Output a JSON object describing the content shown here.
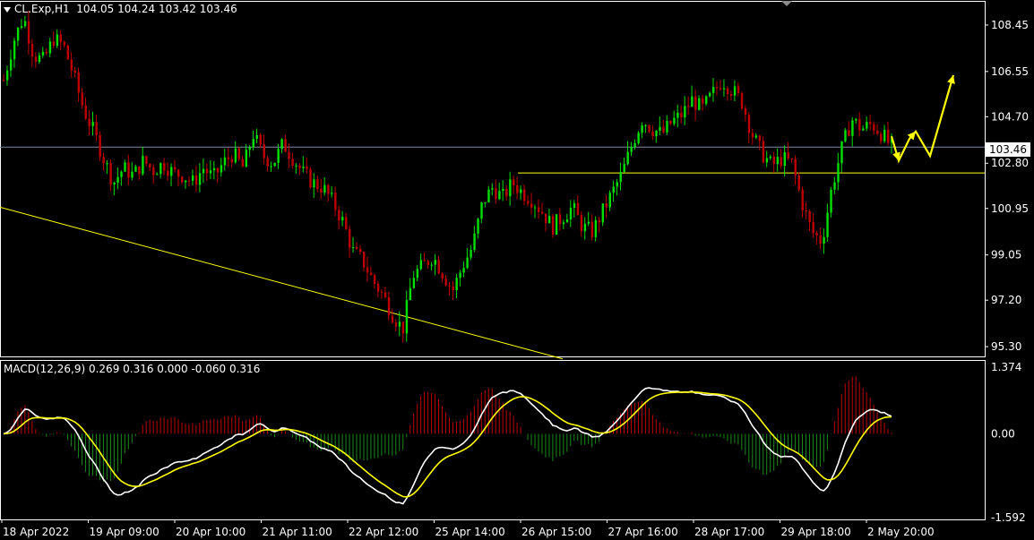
{
  "header": {
    "symbol": "CL.Exp,H1",
    "open": "104.05",
    "high": "104.24",
    "low": "103.42",
    "close": "103.46"
  },
  "current_price": "103.46",
  "indicator": {
    "name": "MACD(12,26,9)",
    "values": "0.269 0.316 0.000 -0.060 0.316",
    "scale_top": "1.374",
    "scale_zero": "0.00",
    "scale_bottom": "-1.592"
  },
  "colors": {
    "background": "#000000",
    "bull": "#00e000",
    "bear": "#c00000",
    "annotation": "#ffff00",
    "macd_line": "#ffffff",
    "signal_line": "#ffff00",
    "axis": "#ffffff"
  },
  "chart_data": {
    "type": "candlestick",
    "price_ticks": [
      "108.45",
      "106.55",
      "104.70",
      "102.80",
      "100.95",
      "99.05",
      "97.20",
      "95.30"
    ],
    "time_ticks": [
      "18 Apr 2022",
      "19 Apr 09:00",
      "20 Apr 10:00",
      "21 Apr 11:00",
      "22 Apr 12:00",
      "25 Apr 14:00",
      "26 Apr 15:00",
      "27 Apr 16:00",
      "28 Apr 17:00",
      "29 Apr 18:00",
      "2 May 20:00"
    ],
    "close_path": [
      106.2,
      107.8,
      108.8,
      107.2,
      107.0,
      107.9,
      107.6,
      106.4,
      105.0,
      104.1,
      103.0,
      102.0,
      102.6,
      102.3,
      102.9,
      102.5,
      102.8,
      102.4,
      102.3,
      102.0,
      102.6,
      102.2,
      102.8,
      103.2,
      102.6,
      104.0,
      103.1,
      102.8,
      103.6,
      103.0,
      102.4,
      102.0,
      101.8,
      101.2,
      100.4,
      99.2,
      98.8,
      98.0,
      97.4,
      96.6,
      96.0,
      98.2,
      98.6,
      99.0,
      98.3,
      97.6,
      98.6,
      99.4,
      101.2,
      101.8,
      101.4,
      102.0,
      101.6,
      101.3,
      100.8,
      100.2,
      100.6,
      101.0,
      100.2,
      100.0,
      100.8,
      101.6,
      102.4,
      103.6,
      104.6,
      104.2,
      104.0,
      104.5,
      104.8,
      105.4,
      105.0,
      105.6,
      106.2,
      105.8,
      105.3,
      104.0,
      103.2,
      102.7,
      103.0,
      102.8,
      101.2,
      100.0,
      99.6,
      101.8,
      103.4,
      104.6,
      104.2,
      104.4,
      104.0,
      103.46
    ],
    "forecast_path": [
      103.9,
      102.9,
      103.8,
      104.1,
      103.1,
      106.4
    ],
    "trendline_from": 101.0,
    "trendline_to": 94.8,
    "horizontal_level": 102.4,
    "macd_range": [
      -1.592,
      1.374
    ]
  }
}
